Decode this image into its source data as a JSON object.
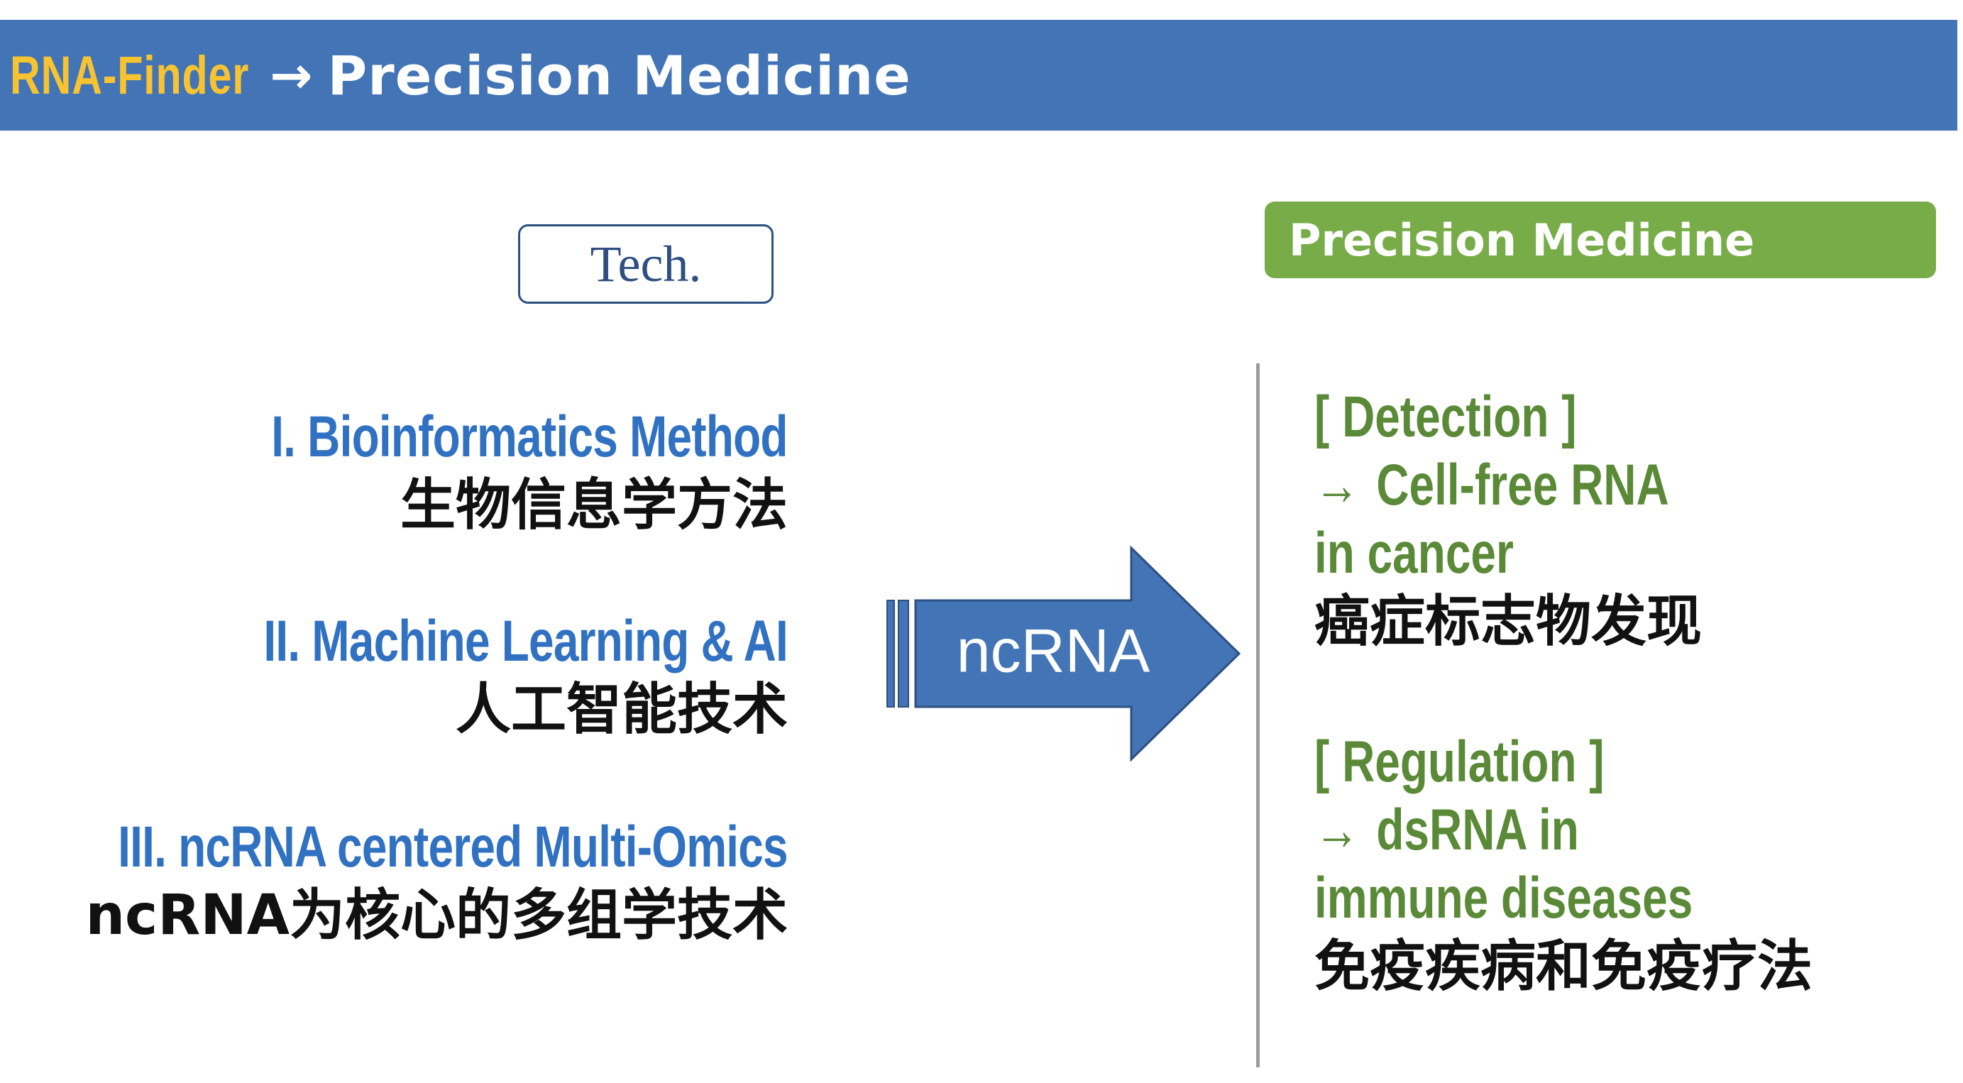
{
  "header": {
    "brand": "RNA-Finder",
    "arrow": "→",
    "title": "Precision Medicine"
  },
  "tech_box": {
    "label": "Tech."
  },
  "precision_box": {
    "label": "Precision Medicine"
  },
  "methods": [
    {
      "en": "I. Bioinformatics Method",
      "cn": "生物信息学方法"
    },
    {
      "en": "II. Machine Learning & AI",
      "cn": "人工智能技术"
    },
    {
      "en": "III. ncRNA centered Multi-Omics",
      "cn": "ncRNA为核心的多组学技术"
    }
  ],
  "center_arrow": {
    "label": "ncRNA",
    "color": "#4274b6"
  },
  "applications": [
    {
      "heading": "[ Detection ]",
      "arrow": "→",
      "line1": "Cell-free RNA",
      "line2": "in cancer",
      "cn": "癌症标志物发现"
    },
    {
      "heading": "[ Regulation ]",
      "arrow": "→",
      "line1": "dsRNA in",
      "line2": "immune diseases",
      "cn": "免疫疾病和免疫疗法"
    }
  ],
  "colors": {
    "header_bg": "#4274b6",
    "brand": "#f7c331",
    "method_blue": "#3071c2",
    "app_green": "#5a8a37",
    "pm_box": "#78ac49",
    "tech_border": "#2e4f80"
  }
}
